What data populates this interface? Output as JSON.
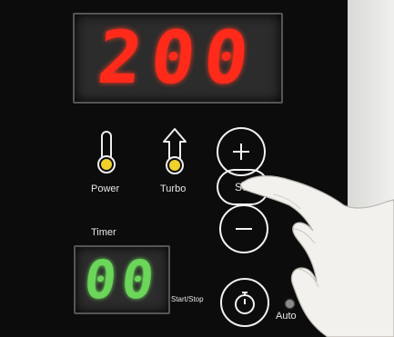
{
  "display": {
    "temperature": "200",
    "timer": "00"
  },
  "labels": {
    "power": "Power",
    "turbo": "Turbo",
    "timer": "Timer",
    "start_stop": "Start/Stop",
    "auto": "Auto",
    "set": "Set"
  },
  "icons": {
    "power": "thermometer-icon",
    "turbo": "turbo-arrow-icon",
    "plus": "plus-icon",
    "minus": "minus-icon",
    "timer": "stopwatch-icon"
  },
  "colors": {
    "temperature_digits": "#ff2a1a",
    "timer_digits": "#6bd65a",
    "indicator_led": "#f0d02a"
  }
}
